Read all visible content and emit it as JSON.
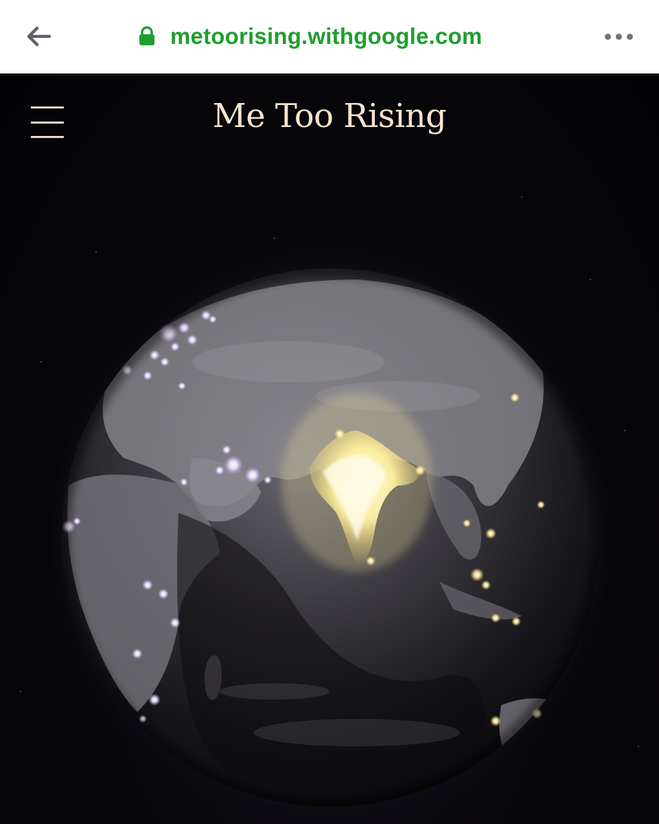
{
  "browser": {
    "url": "metoorising.withgoogle.com",
    "back_icon": "arrow-left-icon",
    "lock_icon": "lock-icon",
    "more_icon": "more-horizontal-icon",
    "url_color": "#1e9e2e"
  },
  "site": {
    "title": "Me Too Rising",
    "menu_icon": "hamburger-menu-icon",
    "title_color": "#f4e3d0"
  },
  "globe": {
    "description_icon": "earth-globe",
    "highlight_color": "#fff3a0",
    "light_color": "#efe2ff"
  }
}
